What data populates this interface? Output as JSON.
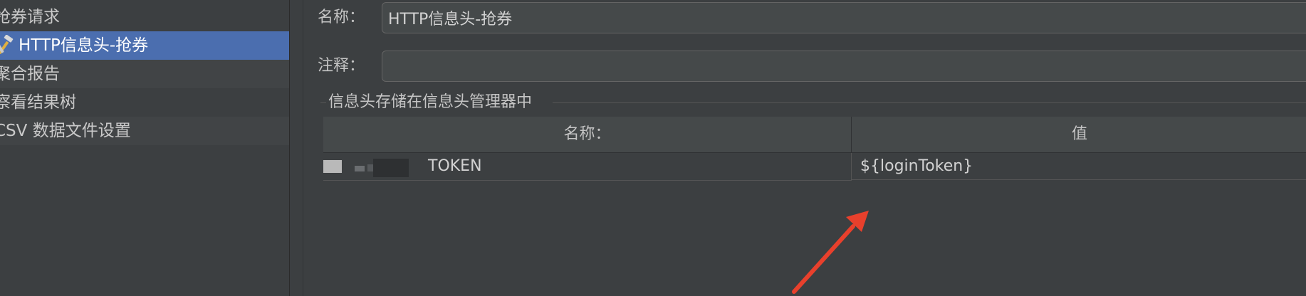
{
  "tree": {
    "items": [
      {
        "label": "抢券请求"
      },
      {
        "label": "HTTP信息头-抢券"
      },
      {
        "label": "聚合报告"
      },
      {
        "label": "察看结果树"
      },
      {
        "label": "CSV 数据文件设置"
      }
    ]
  },
  "form": {
    "name_label": "名称：",
    "name_value": "HTTP信息头-抢券",
    "comment_label": "注释：",
    "comment_value": ""
  },
  "headers_group": {
    "title": "信息头存储在信息头管理器中",
    "columns": [
      "名称：",
      "值"
    ],
    "rows": [
      {
        "name": "TOKEN",
        "value": "${loginToken}"
      }
    ]
  },
  "colors": {
    "selection": "#4b6eaf",
    "arrow": "#e8402c"
  },
  "icons": {
    "selected_item": "wrench-hammer-icon"
  }
}
